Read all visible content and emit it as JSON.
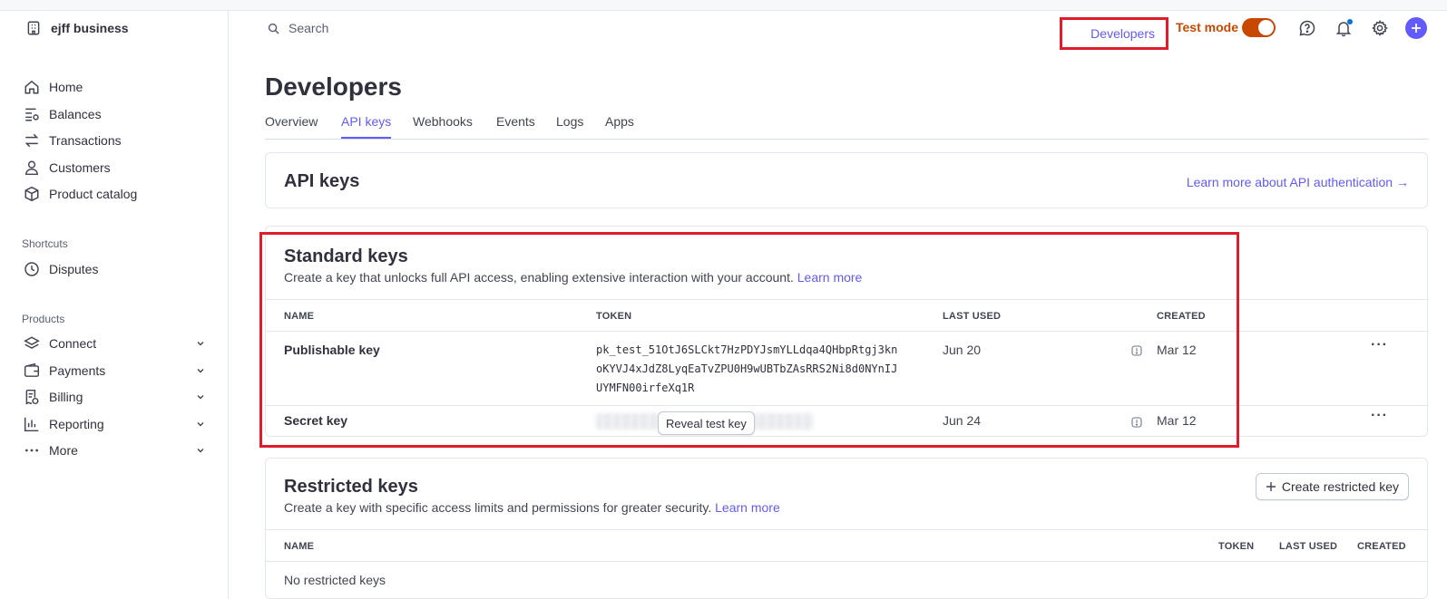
{
  "account": {
    "name": "ejff business"
  },
  "sidebar": {
    "items": [
      {
        "label": "Home"
      },
      {
        "label": "Balances"
      },
      {
        "label": "Transactions"
      },
      {
        "label": "Customers"
      },
      {
        "label": "Product catalog"
      }
    ],
    "shortcuts": {
      "title": "Shortcuts",
      "items": [
        {
          "label": "Disputes"
        }
      ]
    },
    "products": {
      "title": "Products",
      "items": [
        {
          "label": "Connect"
        },
        {
          "label": "Payments"
        },
        {
          "label": "Billing"
        },
        {
          "label": "Reporting"
        },
        {
          "label": "More"
        }
      ]
    }
  },
  "header": {
    "search_placeholder": "Search",
    "developers_label": "Developers",
    "test_mode_label": "Test mode"
  },
  "page": {
    "title": "Developers",
    "tabs": [
      {
        "label": "Overview"
      },
      {
        "label": "API keys"
      },
      {
        "label": "Webhooks"
      },
      {
        "label": "Events"
      },
      {
        "label": "Logs"
      },
      {
        "label": "Apps"
      }
    ]
  },
  "api_keys": {
    "title": "API keys",
    "learn_link": "Learn more about API authentication →"
  },
  "standard_keys": {
    "title": "Standard keys",
    "description": "Create a key that unlocks full API access, enabling extensive interaction with your account.",
    "learn_more": "Learn more",
    "columns": {
      "name": "NAME",
      "token": "TOKEN",
      "last_used": "LAST USED",
      "created": "CREATED"
    },
    "rows": [
      {
        "name": "Publishable key",
        "token_lines": [
          "pk_test_51OtJ6SLCkt7HzPDYJsmYLLdqa4QHbpRtgj3kn",
          "oKYVJ4xJdZ8LyqEaTvZPU0H9wUBTbZAsRRS2Ni8d0NYnIJ",
          "UYMFN00irfeXq1R"
        ],
        "last_used": "Jun 20",
        "created": "Mar 12"
      },
      {
        "name": "Secret key",
        "reveal_label": "Reveal test key",
        "last_used": "Jun 24",
        "created": "Mar 12"
      }
    ]
  },
  "restricted_keys": {
    "title": "Restricted keys",
    "description": "Create a key with specific access limits and permissions for greater security.",
    "learn_more": "Learn more",
    "create_button": "Create restricted key",
    "columns": {
      "name": "NAME",
      "token": "TOKEN",
      "last_used": "LAST USED",
      "created": "CREATED"
    },
    "empty_text": "No restricted keys"
  },
  "colors": {
    "accent": "#625afa",
    "test_mode": "#c84801",
    "highlight": "#e01b2b"
  },
  "icons": {
    "account": "building-icon",
    "home": "home-icon",
    "balances": "balances-icon",
    "transactions": "arrows-swap-icon",
    "customers": "person-icon",
    "product_catalog": "cube-icon",
    "disputes": "clock-icon",
    "connect": "layers-icon",
    "payments": "wallet-icon",
    "billing": "receipt-icon",
    "reporting": "bar-chart-icon",
    "more": "ellipsis-icon"
  }
}
